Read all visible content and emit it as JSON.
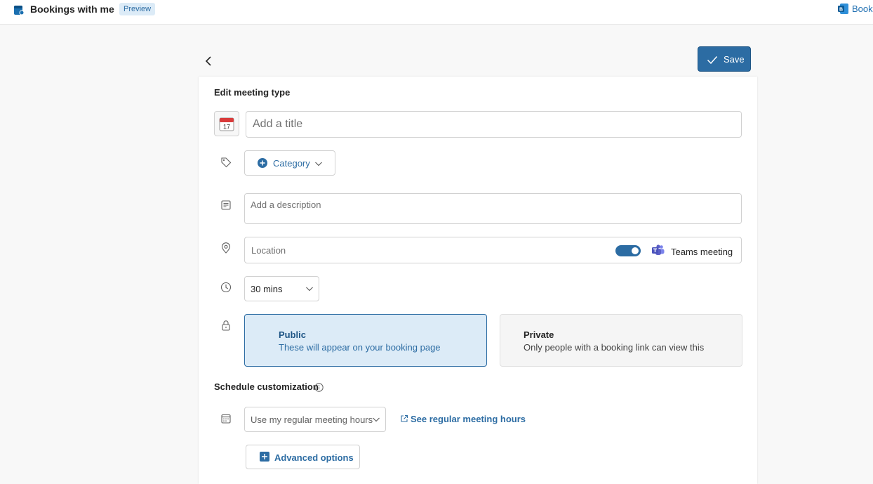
{
  "header": {
    "app_title": "Bookings with me",
    "preview_badge": "Preview",
    "bookings_link_label": "Book",
    "icon": "bookings-app-icon"
  },
  "toolbar": {
    "back_icon": "chevron-left-icon",
    "save_label": "Save"
  },
  "form": {
    "section_title": "Edit meeting type",
    "title_placeholder": "Add a title",
    "title_value": "",
    "category_label": "Category",
    "description_placeholder": "Add a description",
    "location_placeholder": "Location",
    "teams_toggle_on": true,
    "teams_label": "Teams meeting",
    "duration_value": "30 mins",
    "visibility": {
      "selected": "public",
      "public_title": "Public",
      "public_subtitle": "These will appear on your booking page",
      "private_title": "Private",
      "private_subtitle": "Only people with a booking link can view this"
    }
  },
  "schedule": {
    "section_title": "Schedule customization",
    "hours_select_value": "Use my regular meeting hours",
    "see_hours_link": "See regular meeting hours",
    "advanced_options_label": "Advanced options"
  },
  "colors": {
    "accent": "#2c6ca3",
    "selected_card_bg": "#dcebf7",
    "teams_purple": "#5b5fc7"
  }
}
